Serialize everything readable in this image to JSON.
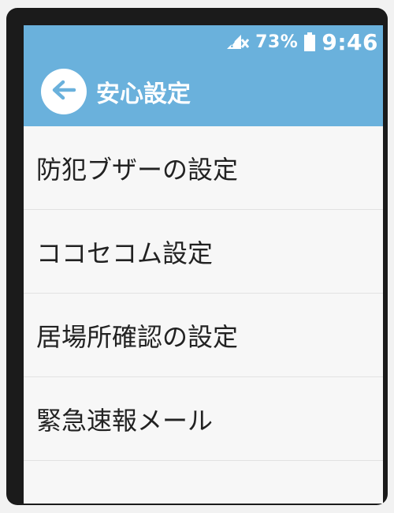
{
  "status_bar": {
    "sim_icon": "no-sim-icon",
    "battery_percent": "73%",
    "battery_icon": "battery-icon",
    "time": "9:46"
  },
  "header": {
    "back_icon": "back-arrow-icon",
    "title": "安心設定"
  },
  "menu": {
    "items": [
      {
        "label": "防犯ブザーの設定"
      },
      {
        "label": "ココセコム設定"
      },
      {
        "label": "居場所確認の設定"
      },
      {
        "label": "緊急速報メール"
      }
    ]
  },
  "colors": {
    "accent": "#6ab1dc",
    "background": "#f7f7f7",
    "text": "#222222",
    "divider": "#e2e2e2"
  }
}
